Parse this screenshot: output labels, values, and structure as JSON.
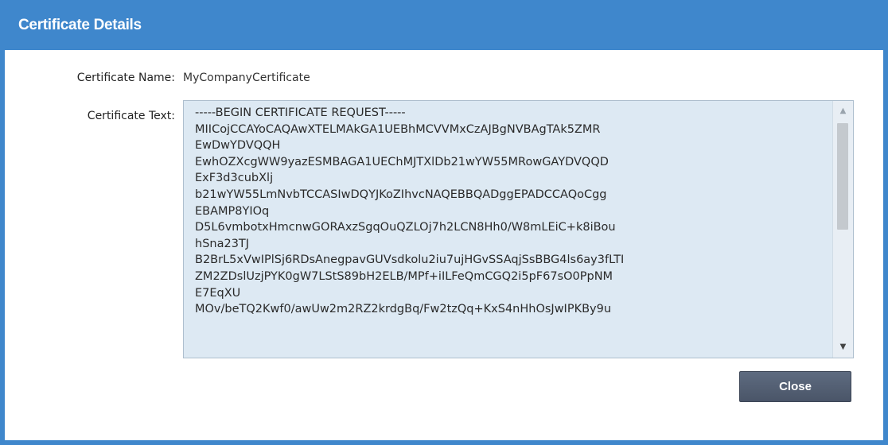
{
  "dialog": {
    "title": "Certificate Details"
  },
  "fields": {
    "name_label": "Certificate Name:",
    "name_value": "MyCompanyCertificate",
    "text_label": "Certificate Text:",
    "text_value": "-----BEGIN CERTIFICATE REQUEST-----\nMIICojCCAYoCAQAwXTELMAkGA1UEBhMCVVMxCzAJBgNVBAgTAk5ZMR\nEwDwYDVQQH\nEwhOZXcgWW9yazESMBAGA1UEChMJTXlDb21wYW55MRowGAYDVQQD\nExF3d3cubXlj\nb21wYW55LmNvbTCCASIwDQYJKoZIhvcNAQEBBQADggEPADCCAQoCgg\nEBAMP8YIOq\nD5L6vmbotxHmcnwGORAxzSgqOuQZLOj7h2LCN8Hh0/W8mLEiC+k8iBou\nhSna23TJ\nB2BrL5xVwIPlSj6RDsAnegpavGUVsdkolu2iu7ujHGvSSAqjSsBBG4ls6ay3fLTI\nZM2ZDslUzjPYK0gW7LStS89bH2ELB/MPf+iILFeQmCGQ2i5pF67sO0PpNM\nE7EqXU\nMOv/beTQ2Kwf0/awUw2m2RZ2krdgBq/Fw2tzQq+KxS4nHhOsJwIPKBy9u"
  },
  "buttons": {
    "close_label": "Close"
  },
  "scrollbar": {
    "up_icon": "▲",
    "down_icon": "▼"
  },
  "colors": {
    "titlebar": "#3f87cc",
    "textarea_bg": "#dde9f3",
    "button": "#4f5a6d"
  }
}
